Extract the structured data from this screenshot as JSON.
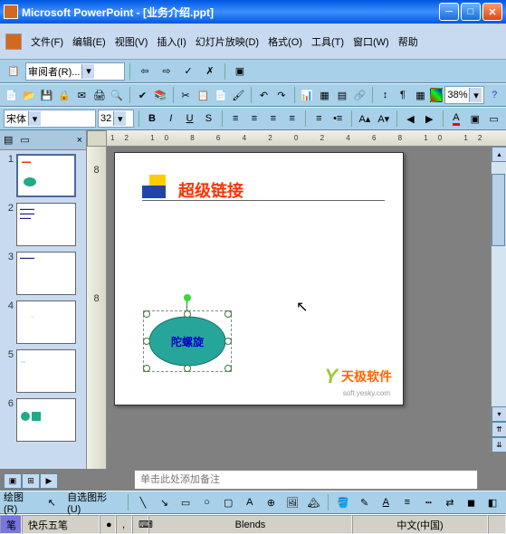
{
  "title": "Microsoft PowerPoint - [业务介绍.ppt]",
  "menus": {
    "file": "文件(F)",
    "edit": "编辑(E)",
    "view": "视图(V)",
    "insert": "插入(I)",
    "slideshow": "幻灯片放映(D)",
    "format": "格式(O)",
    "tools": "工具(T)",
    "window": "窗口(W)",
    "help": "帮助"
  },
  "review": {
    "label": "审阅者(R)..."
  },
  "toolbar": {
    "zoom": "38%"
  },
  "format_bar": {
    "font": "宋体",
    "size": "32"
  },
  "ruler": {
    "h": "12 10 8 6 4 2 0 2 4 6 8 10 12",
    "v": [
      "8",
      "8"
    ]
  },
  "thumbs": [
    {
      "n": "1"
    },
    {
      "n": "2"
    },
    {
      "n": "3"
    },
    {
      "n": "4"
    },
    {
      "n": "5"
    },
    {
      "n": "6"
    }
  ],
  "slide": {
    "title": "超级链接",
    "shape_text": "陀螺旋",
    "watermark": "天极软件",
    "watermark_sub": "soft.yesky.com"
  },
  "notes": {
    "placeholder": "单击此处添加备注"
  },
  "drawbar": {
    "draw": "绘图(R)",
    "autoshape": "自选图形(U)"
  },
  "status": {
    "ime": "快乐五笔",
    "design": "Blends",
    "lang": "中文(中国)"
  }
}
